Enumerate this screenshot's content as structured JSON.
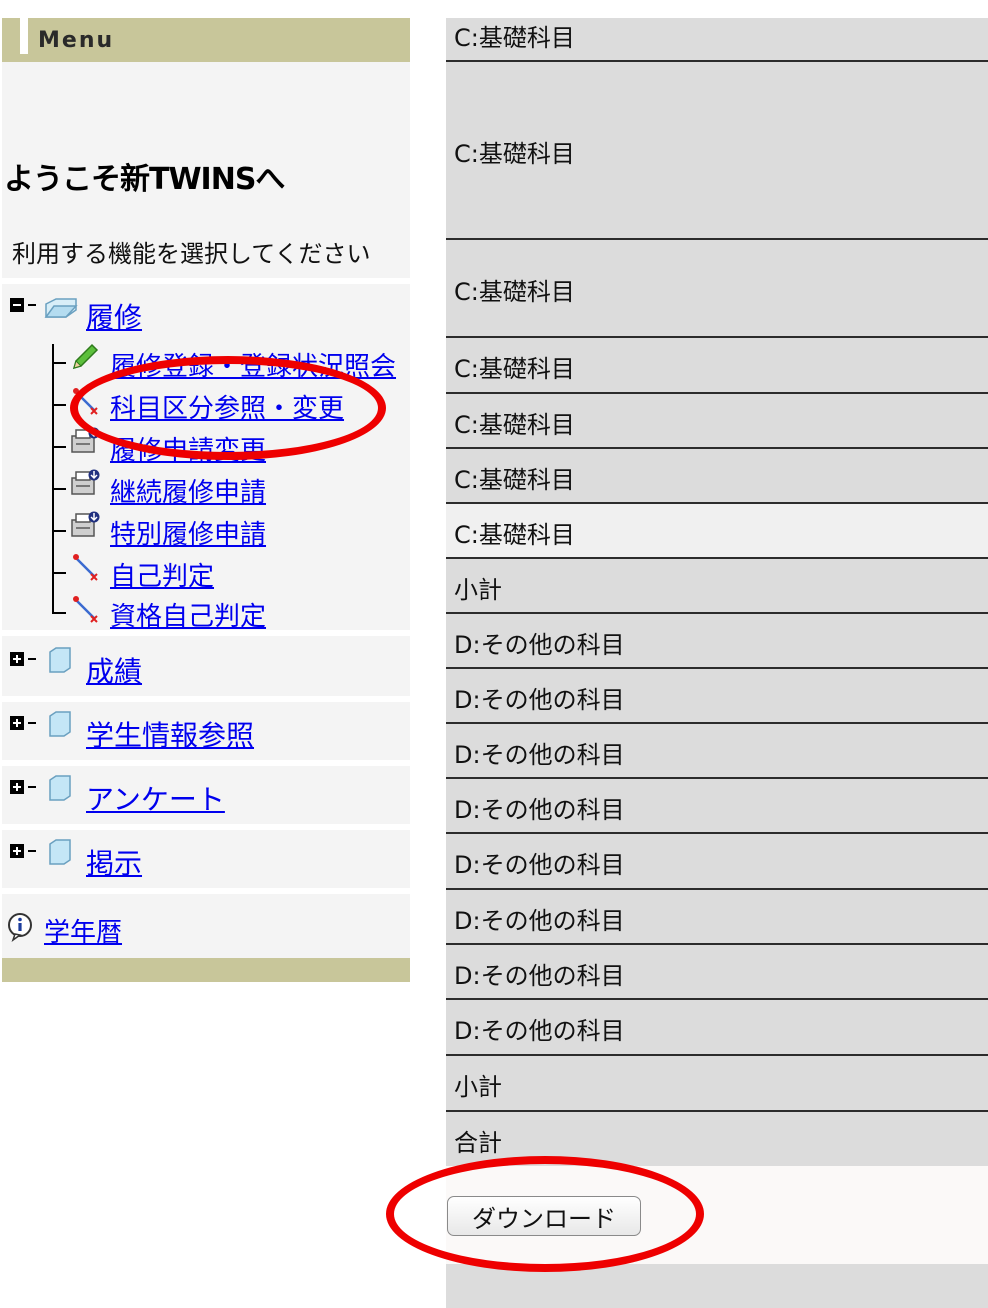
{
  "menu": {
    "title": "Menu",
    "welcome": "ようこそ新TWINSへ",
    "instruction": "利用する機能を選択してください",
    "categories": [
      {
        "label": "履修",
        "expanded": true,
        "items": [
          {
            "label": "履修登録・登録状況照会",
            "icon": "pencil-icon"
          },
          {
            "label": "科目区分参照・変更",
            "icon": "magic-wand-icon"
          },
          {
            "label": "履修申請変更",
            "icon": "printer-download-icon"
          },
          {
            "label": "継続履修申請",
            "icon": "printer-download-icon"
          },
          {
            "label": "特別履修申請",
            "icon": "printer-download-icon"
          },
          {
            "label": "自己判定",
            "icon": "magic-wand-icon"
          },
          {
            "label": "資格自己判定",
            "icon": "magic-wand-icon"
          }
        ]
      },
      {
        "label": "成績",
        "expanded": false
      },
      {
        "label": "学生情報参照",
        "expanded": false
      },
      {
        "label": "アンケート",
        "expanded": false
      },
      {
        "label": "掲示",
        "expanded": false
      }
    ],
    "calendar_link": "学年暦"
  },
  "table": {
    "rows": [
      "C:基礎科目",
      "C:基礎科目",
      "C:基礎科目",
      "C:基礎科目",
      "C:基礎科目",
      "C:基礎科目",
      "C:基礎科目",
      "小計",
      "D:その他の科目",
      "D:その他の科目",
      "D:その他の科目",
      "D:その他の科目",
      "D:その他の科目",
      "D:その他の科目",
      "D:その他の科目",
      "D:その他の科目",
      "小計",
      "合計"
    ]
  },
  "download_button": "ダウンロード",
  "colors": {
    "menu_header": "#c8c69a",
    "menu_background": "#f4f4f4",
    "table_row": "#dcdcdc",
    "link": "#0000ee",
    "annotation": "#ee0000"
  }
}
